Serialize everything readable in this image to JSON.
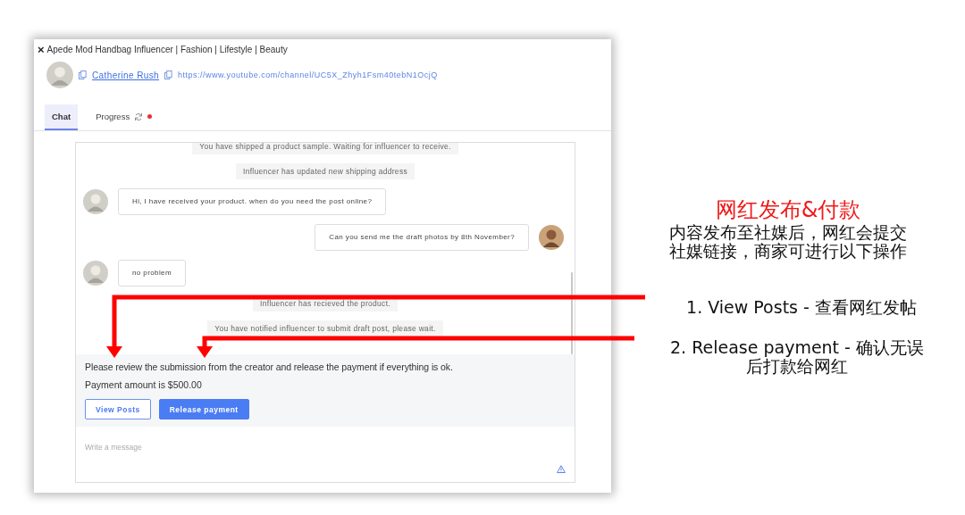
{
  "window": {
    "close_label": "×",
    "title": "Apede Mod Handbag Influencer | Fashion | Lifestyle | Beauty",
    "creator_name": "Catherine Rush",
    "channel_url": "https://www.youtube.com/channel/UC5X_Zhyh1Fsm40tebN1OcjQ"
  },
  "tabs": [
    {
      "label": "Chat",
      "selected": true,
      "kind": "chat",
      "notification": false
    },
    {
      "label": "Progress",
      "selected": false,
      "kind": "progress",
      "notification": true
    }
  ],
  "messages": [
    {
      "kind": "system",
      "text": "You have shipped a product sample. Waiting for influencer to receive."
    },
    {
      "kind": "system",
      "text": "Influencer has updated new shipping address"
    },
    {
      "kind": "incoming",
      "text": "Hi, I have received your product. when do you need the post online?"
    },
    {
      "kind": "outgoing",
      "text": "Can you send me the draft photos by 8th November?"
    },
    {
      "kind": "incoming",
      "text": "no problem"
    },
    {
      "kind": "system",
      "text": "Influencer has recieved the product."
    },
    {
      "kind": "system",
      "text": "You have notified influencer to submit draft post, please wait."
    }
  ],
  "payment_panel": {
    "instruction": "Please review the submission from the creator and release the payment if everything is ok.",
    "amount": "Payment amount is $500.00",
    "buttons": [
      {
        "label": "View Posts",
        "kind": "secondary"
      },
      {
        "label": "Release payment",
        "kind": "primary"
      }
    ]
  },
  "composer": {
    "placeholder": "Write a message"
  },
  "annotation": {
    "title": "网红发布&付款",
    "description": "内容发布至社媒后，网红会提交社媒链接，商家可进行以下操作",
    "steps": [
      "1. View Posts - 查看网红发帖",
      "2. Release payment - 确认无误后打款给网红"
    ]
  }
}
